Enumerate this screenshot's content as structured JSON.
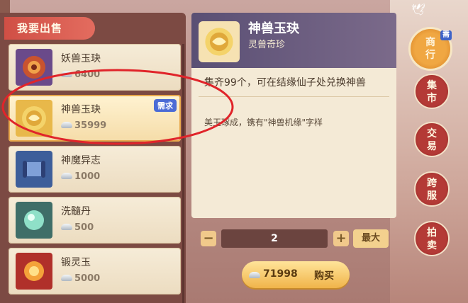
{
  "sell_panel": {
    "header": "我要出售",
    "items": [
      {
        "name": "妖兽玉玦",
        "price": "6400",
        "icon": "red-jade-icon",
        "badge": ""
      },
      {
        "name": "神兽玉玦",
        "price": "35999",
        "icon": "gold-jade-icon",
        "badge": "需求"
      },
      {
        "name": "神魔异志",
        "price": "1000",
        "icon": "scroll-icon",
        "badge": ""
      },
      {
        "name": "洗髓丹",
        "price": "500",
        "icon": "green-pill-icon",
        "badge": ""
      },
      {
        "name": "锻灵玉",
        "price": "5000",
        "icon": "orange-orb-icon",
        "badge": ""
      }
    ]
  },
  "detail": {
    "title": "神兽玉玦",
    "subtitle": "灵兽奇珍",
    "description": "集齐99个，可在结缘仙子处兑换神兽",
    "flavor": "美玉琢成，镌有\"神兽机缘\"字样"
  },
  "quantity": {
    "minus": "−",
    "value": "2",
    "plus": "+",
    "max_label": "最大"
  },
  "buy": {
    "total_price": "71998",
    "label": "购买"
  },
  "nav": {
    "items": [
      {
        "label": "商行",
        "active": true,
        "badge": "需"
      },
      {
        "label": "集市",
        "active": false
      },
      {
        "label": "交易",
        "active": false
      },
      {
        "label": "跨服",
        "active": false
      },
      {
        "label": "拍卖",
        "active": false
      }
    ]
  },
  "colors": {
    "selected_border": "#e8a84b",
    "badge_blue": "#4b6bd6",
    "annotation_red": "#e0242a"
  }
}
